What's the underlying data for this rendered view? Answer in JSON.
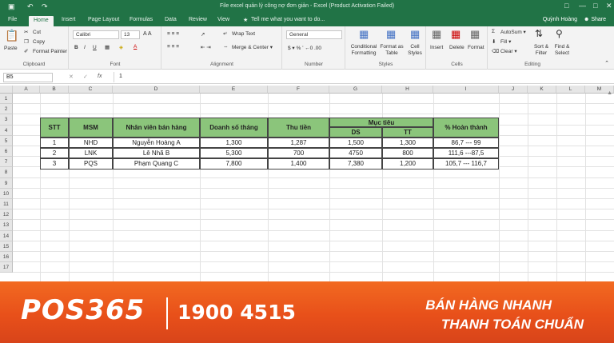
{
  "title_bar": {
    "save_icon": "save-icon",
    "undo_icon": "undo-icon",
    "redo_icon": "redo-icon",
    "title": "File excel quản lý công nợ đơn giản - Excel (Product Activation Failed)"
  },
  "tabs": [
    "File",
    "Home",
    "Insert",
    "Page Layout",
    "Formulas",
    "Data",
    "Review",
    "View"
  ],
  "active_tab": "Home",
  "tell_me": "Tell me what you want to do...",
  "user": "Quỳnh Hoàng",
  "share": "Share",
  "ribbon": {
    "clipboard": {
      "paste": "Paste",
      "cut": "Cut",
      "copy": "Copy",
      "format_painter": "Format Painter",
      "label": "Clipboard"
    },
    "font": {
      "name": "Calibri",
      "size": "13",
      "label": "Font"
    },
    "alignment": {
      "wrap_text": "Wrap Text",
      "merge_center": "Merge & Center",
      "label": "Alignment"
    },
    "number": {
      "format": "General",
      "label": "Number"
    },
    "styles": {
      "conditional": "Conditional Formatting",
      "format_as_table": "Format as Table",
      "cell_styles": "Cell Styles",
      "label": "Styles"
    },
    "cells": {
      "insert": "Insert",
      "delete": "Delete",
      "format": "Format",
      "label": "Cells"
    },
    "editing": {
      "autosum": "AutoSum",
      "fill": "Fill",
      "clear": "Clear",
      "sort_filter": "Sort & Filter",
      "find_select": "Find & Select",
      "label": "Editing"
    }
  },
  "formula_bar": {
    "name_box": "B5",
    "fx": "fx",
    "value": "1"
  },
  "columns": [
    "A",
    "B",
    "C",
    "D",
    "E",
    "F",
    "G",
    "H",
    "I",
    "J",
    "K",
    "L",
    "M"
  ],
  "rows": [
    "1",
    "2",
    "3",
    "4",
    "5",
    "6",
    "7",
    "8",
    "9",
    "10",
    "11",
    "12",
    "13",
    "14",
    "15",
    "16",
    "17"
  ],
  "table": {
    "headers": {
      "stt": "STT",
      "msm": "MSM",
      "employee": "Nhân viên bán hàng",
      "monthly_sales": "Doanh số tháng",
      "collected": "Thu tiền",
      "target": "Mục tiêu",
      "target_ds": "DS",
      "target_tt": "TT",
      "completion": "% Hoàn thành"
    },
    "rows": [
      [
        "1",
        "NHD",
        "Nguyễn Hoàng A",
        "1,300",
        "1,287",
        "1,500",
        "1,300",
        "86,7 --- 99"
      ],
      [
        "2",
        "LNK",
        "Lê Nhã B",
        "5,300",
        "700",
        "4750",
        "800",
        "111,6 ---87,5"
      ],
      [
        "3",
        "PQS",
        "Phạm Quang C",
        "7,800",
        "1,400",
        "7,380",
        "1,200",
        "105,7 --- 116,7"
      ]
    ]
  },
  "banner": {
    "logo": "POS365",
    "phone": "1900 4515",
    "slogan_1": "BÁN HÀNG NHANH",
    "slogan_2": "THANH TOÁN CHUẨN"
  },
  "colors": {
    "excel_green": "#217346",
    "header_fill": "#8bc57b",
    "banner_orange": "#f26a21"
  }
}
